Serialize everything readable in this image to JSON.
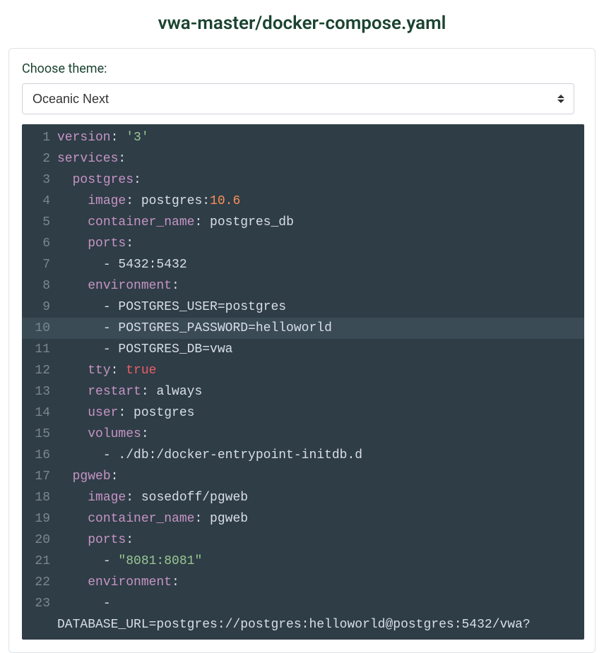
{
  "title": "vwa-master/docker-compose.yaml",
  "choose_label": "Choose theme:",
  "theme_selected": "Oceanic Next",
  "code": {
    "highlighted_line": 10,
    "lines": [
      {
        "n": 1,
        "indent": 0,
        "tokens": [
          {
            "t": "version",
            "c": "key"
          },
          {
            "t": ": ",
            "c": "plain"
          },
          {
            "t": "'3'",
            "c": "str"
          }
        ]
      },
      {
        "n": 2,
        "indent": 0,
        "tokens": [
          {
            "t": "services",
            "c": "key"
          },
          {
            "t": ":",
            "c": "plain"
          }
        ]
      },
      {
        "n": 3,
        "indent": 2,
        "tokens": [
          {
            "t": "postgres",
            "c": "key"
          },
          {
            "t": ":",
            "c": "plain"
          }
        ]
      },
      {
        "n": 4,
        "indent": 4,
        "tokens": [
          {
            "t": "image",
            "c": "key"
          },
          {
            "t": ": postgres:",
            "c": "plain"
          },
          {
            "t": "10.6",
            "c": "num"
          }
        ]
      },
      {
        "n": 5,
        "indent": 4,
        "tokens": [
          {
            "t": "container_name",
            "c": "key"
          },
          {
            "t": ": postgres_db",
            "c": "plain"
          }
        ]
      },
      {
        "n": 6,
        "indent": 4,
        "tokens": [
          {
            "t": "ports",
            "c": "key"
          },
          {
            "t": ":",
            "c": "plain"
          }
        ]
      },
      {
        "n": 7,
        "indent": 6,
        "tokens": [
          {
            "t": "- 5432:5432",
            "c": "plain"
          }
        ]
      },
      {
        "n": 8,
        "indent": 4,
        "tokens": [
          {
            "t": "environment",
            "c": "key"
          },
          {
            "t": ":",
            "c": "plain"
          }
        ]
      },
      {
        "n": 9,
        "indent": 6,
        "tokens": [
          {
            "t": "- POSTGRES_USER=postgres",
            "c": "plain"
          }
        ]
      },
      {
        "n": 10,
        "indent": 6,
        "tokens": [
          {
            "t": "- POSTGRES_PASSWORD=helloworld",
            "c": "plain"
          }
        ]
      },
      {
        "n": 11,
        "indent": 6,
        "tokens": [
          {
            "t": "- POSTGRES_DB=vwa",
            "c": "plain"
          }
        ]
      },
      {
        "n": 12,
        "indent": 4,
        "tokens": [
          {
            "t": "tty",
            "c": "key"
          },
          {
            "t": ": ",
            "c": "plain"
          },
          {
            "t": "true",
            "c": "bool"
          }
        ]
      },
      {
        "n": 13,
        "indent": 4,
        "tokens": [
          {
            "t": "restart",
            "c": "key"
          },
          {
            "t": ": always",
            "c": "plain"
          }
        ]
      },
      {
        "n": 14,
        "indent": 4,
        "tokens": [
          {
            "t": "user",
            "c": "key"
          },
          {
            "t": ": postgres",
            "c": "plain"
          }
        ]
      },
      {
        "n": 15,
        "indent": 4,
        "tokens": [
          {
            "t": "volumes",
            "c": "key"
          },
          {
            "t": ":",
            "c": "plain"
          }
        ]
      },
      {
        "n": 16,
        "indent": 6,
        "tokens": [
          {
            "t": "- ./db:/docker-entrypoint-initdb.d",
            "c": "plain"
          }
        ]
      },
      {
        "n": 17,
        "indent": 2,
        "tokens": [
          {
            "t": "pgweb",
            "c": "key"
          },
          {
            "t": ":",
            "c": "plain"
          }
        ]
      },
      {
        "n": 18,
        "indent": 4,
        "tokens": [
          {
            "t": "image",
            "c": "key"
          },
          {
            "t": ": sosedoff/pgweb",
            "c": "plain"
          }
        ]
      },
      {
        "n": 19,
        "indent": 4,
        "tokens": [
          {
            "t": "container_name",
            "c": "key"
          },
          {
            "t": ": pgweb",
            "c": "plain"
          }
        ]
      },
      {
        "n": 20,
        "indent": 4,
        "tokens": [
          {
            "t": "ports",
            "c": "key"
          },
          {
            "t": ":",
            "c": "plain"
          }
        ]
      },
      {
        "n": 21,
        "indent": 6,
        "tokens": [
          {
            "t": "- ",
            "c": "plain"
          },
          {
            "t": "\"8081:8081\"",
            "c": "str"
          }
        ]
      },
      {
        "n": 22,
        "indent": 4,
        "tokens": [
          {
            "t": "environment",
            "c": "key"
          },
          {
            "t": ":",
            "c": "plain"
          }
        ]
      },
      {
        "n": 23,
        "indent": 6,
        "tokens": [
          {
            "t": "-",
            "c": "plain"
          }
        ]
      },
      {
        "n": "",
        "indent": 0,
        "tokens": [
          {
            "t": "DATABASE_URL=postgres://postgres:helloworld@postgres:5432/vwa?",
            "c": "plain"
          }
        ]
      }
    ]
  }
}
